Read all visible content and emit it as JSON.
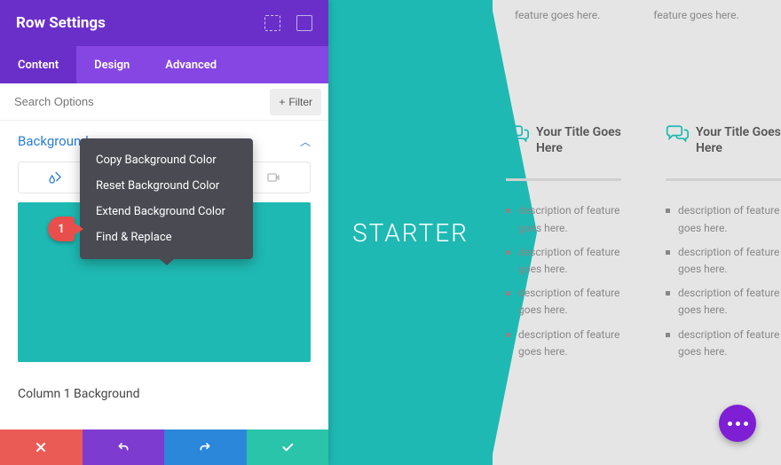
{
  "panel": {
    "title": "Row Settings",
    "tabs": [
      "Content",
      "Design",
      "Advanced"
    ],
    "active_tab": 0,
    "search_placeholder": "Search Options",
    "filter_label": "Filter",
    "section_title": "Background",
    "column_label": "Column 1 Background"
  },
  "context_menu": {
    "items": [
      "Copy Background Color",
      "Reset Background Color",
      "Extend Background Color",
      "Find & Replace"
    ]
  },
  "annotation": {
    "num": "1"
  },
  "preview": {
    "starter": "STARTER",
    "top_snippet": "feature goes here.",
    "card_title": "Your Title Goes Here",
    "feature_line": "description of feature goes here."
  }
}
